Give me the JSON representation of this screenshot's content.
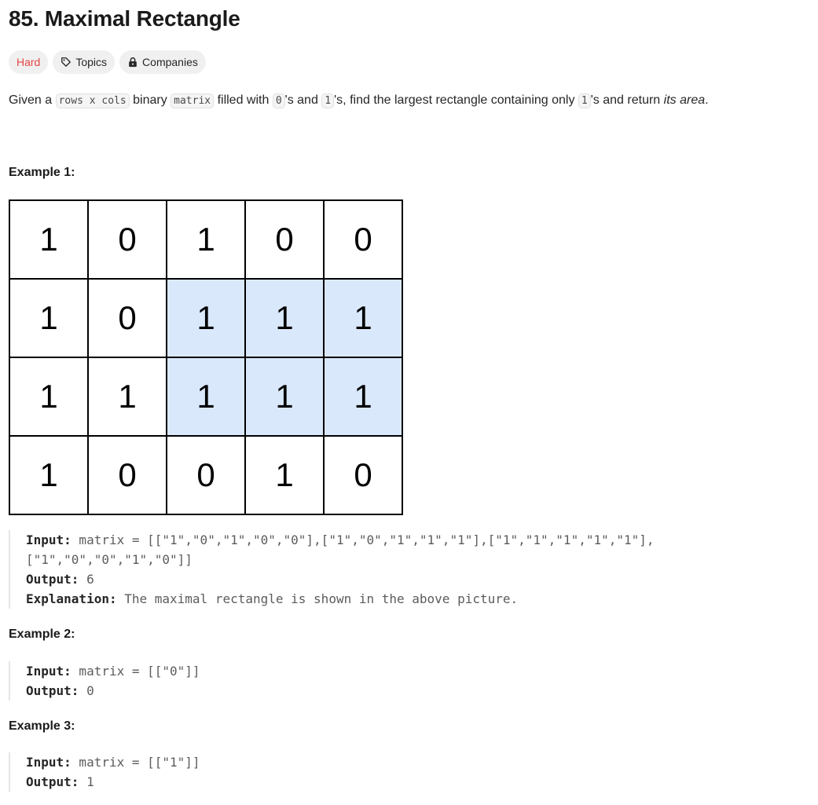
{
  "problem": {
    "title": "85. Maximal Rectangle",
    "tags": {
      "difficulty": "Hard",
      "topics": "Topics",
      "companies": "Companies"
    },
    "description": {
      "p1": "Given a ",
      "c1": "rows x cols",
      "p2": " binary ",
      "c2": "matrix",
      "p3": " filled with ",
      "c3": "0",
      "p4": "'s and ",
      "c4": "1",
      "p5": "'s, find the largest rectangle containing only ",
      "c5": "1",
      "p6": "'s and return ",
      "p7": "its area",
      "p8": "."
    }
  },
  "grid": {
    "rows": [
      [
        "1",
        "0",
        "1",
        "0",
        "0"
      ],
      [
        "1",
        "0",
        "1",
        "1",
        "1"
      ],
      [
        "1",
        "1",
        "1",
        "1",
        "1"
      ],
      [
        "1",
        "0",
        "0",
        "1",
        "0"
      ]
    ],
    "highlighted": [
      [
        1,
        2
      ],
      [
        1,
        3
      ],
      [
        1,
        4
      ],
      [
        2,
        2
      ],
      [
        2,
        3
      ],
      [
        2,
        4
      ]
    ],
    "highlight_color": "#dae8fc"
  },
  "examples": [
    {
      "heading": "Example 1:",
      "input_label": "Input:",
      "input_line1": " matrix = [[\"1\",\"0\",\"1\",\"0\",\"0\"],[\"1\",\"0\",\"1\",\"1\",\"1\"],[\"1\",\"1\",\"1\",\"1\",\"1\"],",
      "input_line2": "[\"1\",\"0\",\"0\",\"1\",\"0\"]]",
      "output_label": "Output:",
      "output": " 6",
      "explanation_label": "Explanation:",
      "explanation": " The maximal rectangle is shown in the above picture."
    },
    {
      "heading": "Example 2:",
      "input_label": "Input:",
      "input_line1": " matrix = [[\"0\"]]",
      "output_label": "Output:",
      "output": " 0"
    },
    {
      "heading": "Example 3:",
      "input_label": "Input:",
      "input_line1": " matrix = [[\"1\"]]",
      "output_label": "Output:",
      "output": " 1"
    }
  ],
  "colors": {
    "hard": "#e64545",
    "tag_bg": "#f0f0f0"
  }
}
